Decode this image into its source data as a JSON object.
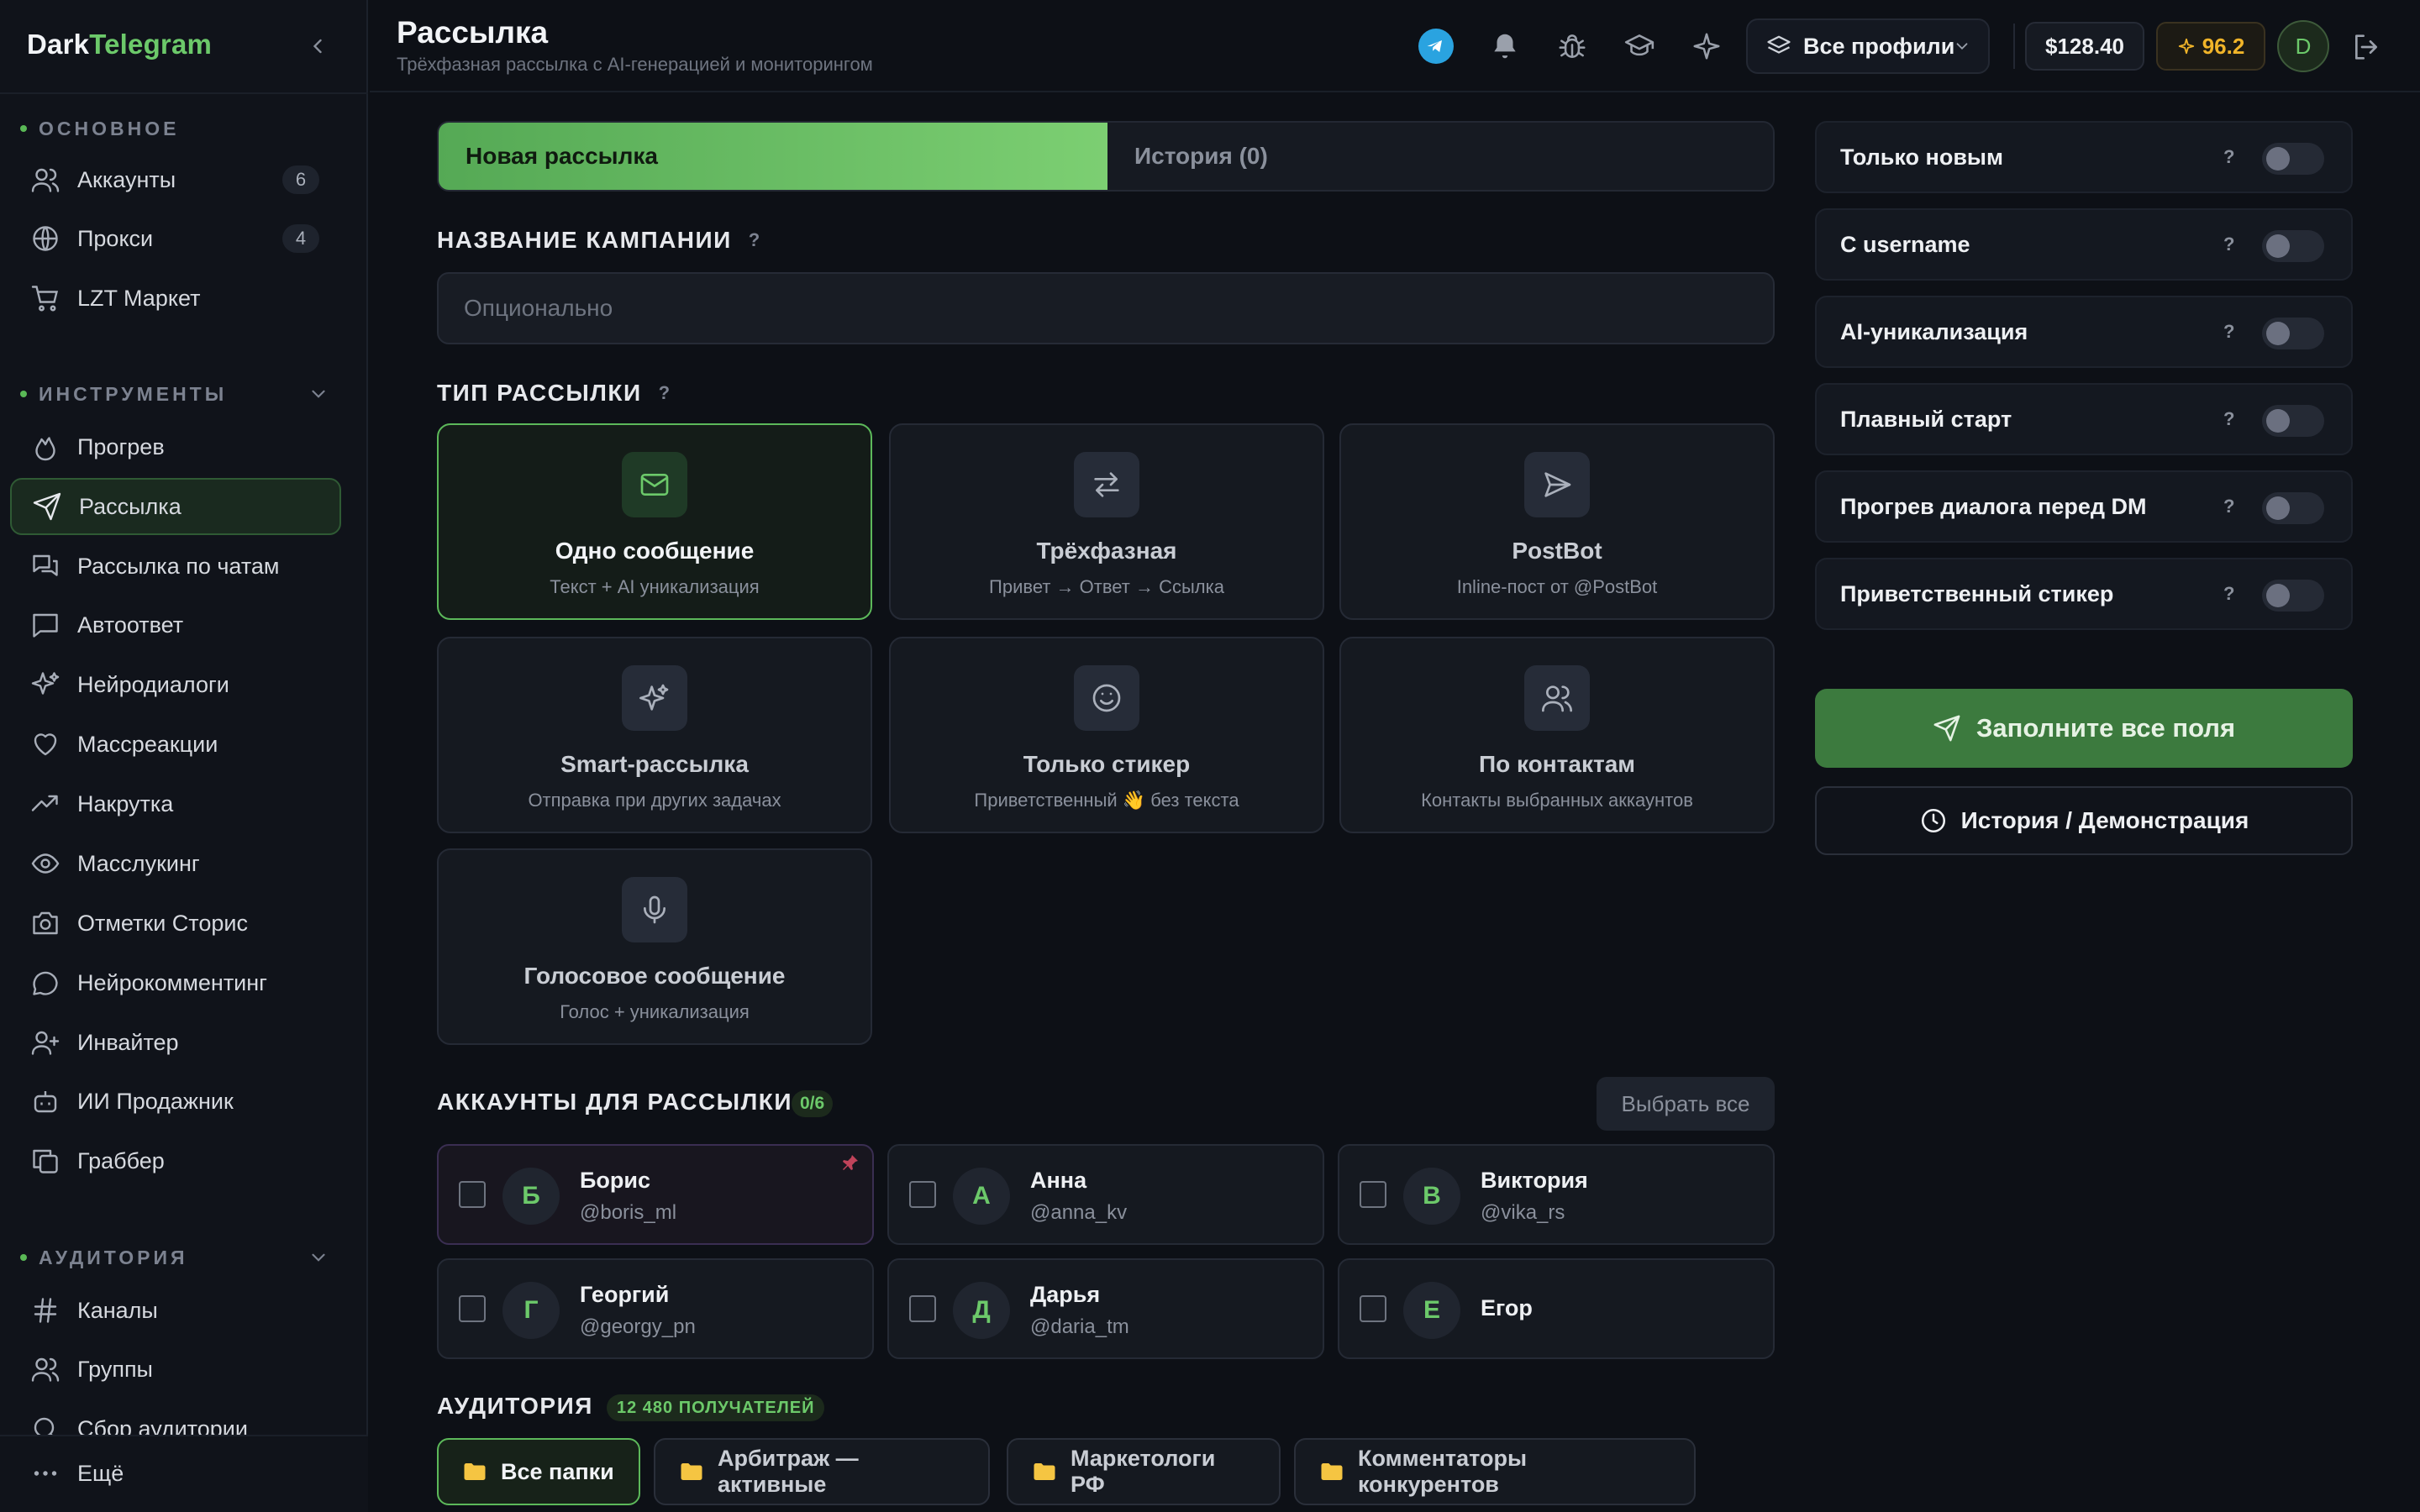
{
  "brand": {
    "part1": "Dark",
    "part2": "Telegram"
  },
  "sidebar": {
    "sections": {
      "main": "ОСНОВНОЕ",
      "tools": "ИНСТРУМЕНТЫ",
      "audience": "АУДИТОРИЯ"
    },
    "main_items": [
      {
        "label": "Аккаунты",
        "count": "6",
        "icon": "users-icon"
      },
      {
        "label": "Прокси",
        "count": "4",
        "icon": "globe-icon"
      },
      {
        "label": "LZT Маркет",
        "icon": "cart-icon"
      }
    ],
    "tool_items": [
      {
        "label": "Прогрев",
        "icon": "flame-icon"
      },
      {
        "label": "Рассылка",
        "icon": "send-icon",
        "active": true
      },
      {
        "label": "Рассылка по чатам",
        "icon": "chats-icon"
      },
      {
        "label": "Автоответ",
        "icon": "message-square-icon"
      },
      {
        "label": "Нейродиалоги",
        "icon": "sparkles-icon"
      },
      {
        "label": "Массреакции",
        "icon": "heart-icon"
      },
      {
        "label": "Накрутка",
        "icon": "trending-up-icon"
      },
      {
        "label": "Масслукинг",
        "icon": "eye-icon"
      },
      {
        "label": "Отметки Сторис",
        "icon": "camera-icon"
      },
      {
        "label": "Нейрокомментинг",
        "icon": "message-circle-icon"
      },
      {
        "label": "Инвайтер",
        "icon": "user-plus-icon"
      },
      {
        "label": "ИИ Продажник",
        "icon": "bot-icon"
      },
      {
        "label": "Граббер",
        "icon": "copy-icon"
      }
    ],
    "audience_items": [
      {
        "label": "Каналы",
        "icon": "hash-icon"
      },
      {
        "label": "Группы",
        "icon": "users-icon"
      },
      {
        "label": "Сбор аудитории",
        "icon": "search-icon"
      }
    ],
    "more_label": "Ещё"
  },
  "header": {
    "title": "Рассылка",
    "subtitle": "Трёхфазная рассылка с AI-генерацией и мониторингом",
    "profiles_label": "Все профили",
    "balance": "$128.40",
    "stars": "96.2",
    "avatar_letter": "D"
  },
  "tabs": {
    "new": "Новая рассылка",
    "history": "История (0)"
  },
  "campaign": {
    "label": "НАЗВАНИЕ КАМПАНИИ",
    "help": "?",
    "placeholder": "Опционально"
  },
  "types": {
    "label": "ТИП РАССЫЛКИ",
    "help": "?",
    "items": [
      {
        "title": "Одно сообщение",
        "subtitle": "Текст + AI уникализация",
        "icon": "mail-icon",
        "active": true
      },
      {
        "title": "Трёхфазная",
        "subtitle": "Привет → Ответ → Ссылка",
        "icon": "arrows-swap-icon"
      },
      {
        "title": "PostBot",
        "subtitle": "Inline-пост от @PostBot",
        "icon": "send-icon"
      },
      {
        "title": "Smart-рассылка",
        "subtitle": "Отправка при других задачах",
        "icon": "sparkles-icon"
      },
      {
        "title": "Только стикер",
        "subtitle": "Приветственный 👋 без текста",
        "icon": "smile-icon"
      },
      {
        "title": "По контактам",
        "subtitle": "Контакты выбранных аккаунтов",
        "icon": "contacts-icon"
      },
      {
        "title": "Голосовое сообщение",
        "subtitle": "Голос + уникализация",
        "icon": "mic-icon"
      }
    ]
  },
  "accounts": {
    "label": "АККАУНТЫ ДЛЯ РАССЫЛКИ",
    "count": "0/6",
    "select_all": "Выбрать все",
    "items": [
      {
        "letter": "Б",
        "name": "Борис",
        "username": "@boris_ml",
        "pinned": true
      },
      {
        "letter": "А",
        "name": "Анна",
        "username": "@anna_kv"
      },
      {
        "letter": "В",
        "name": "Виктория",
        "username": "@vika_rs"
      },
      {
        "letter": "Г",
        "name": "Георгий",
        "username": "@georgy_pn"
      },
      {
        "letter": "Д",
        "name": "Дарья",
        "username": "@daria_tm"
      },
      {
        "letter": "Е",
        "name": "Егор",
        "username": ""
      }
    ]
  },
  "audience": {
    "label": "АУДИТОРИЯ",
    "count": "12 480 ПОЛУЧАТЕЛЕЙ",
    "folders": [
      {
        "label": "Все папки",
        "active": true
      },
      {
        "label": "Арбитраж — активные"
      },
      {
        "label": "Маркетологи РФ"
      },
      {
        "label": "Комментаторы конкурентов"
      }
    ]
  },
  "options": [
    {
      "label": "Только новым",
      "help": "?",
      "on": false
    },
    {
      "label": "С username",
      "help": "?",
      "on": false
    },
    {
      "label": "AI-уникализация",
      "help": "?",
      "on": false
    },
    {
      "label": "Плавный старт",
      "help": "?",
      "on": false
    },
    {
      "label": "Прогрев диалога перед DM",
      "help": "?",
      "on": false
    },
    {
      "label": "Приветственный стикер",
      "help": "?",
      "on": false
    }
  ],
  "actions": {
    "submit": "Заполните все поля",
    "history": "История / Демонстрация"
  },
  "colors": {
    "accent": "#6cc96a",
    "background": "#0d1016",
    "telegram": "#2aa3e0",
    "stars": "#f0b429"
  }
}
